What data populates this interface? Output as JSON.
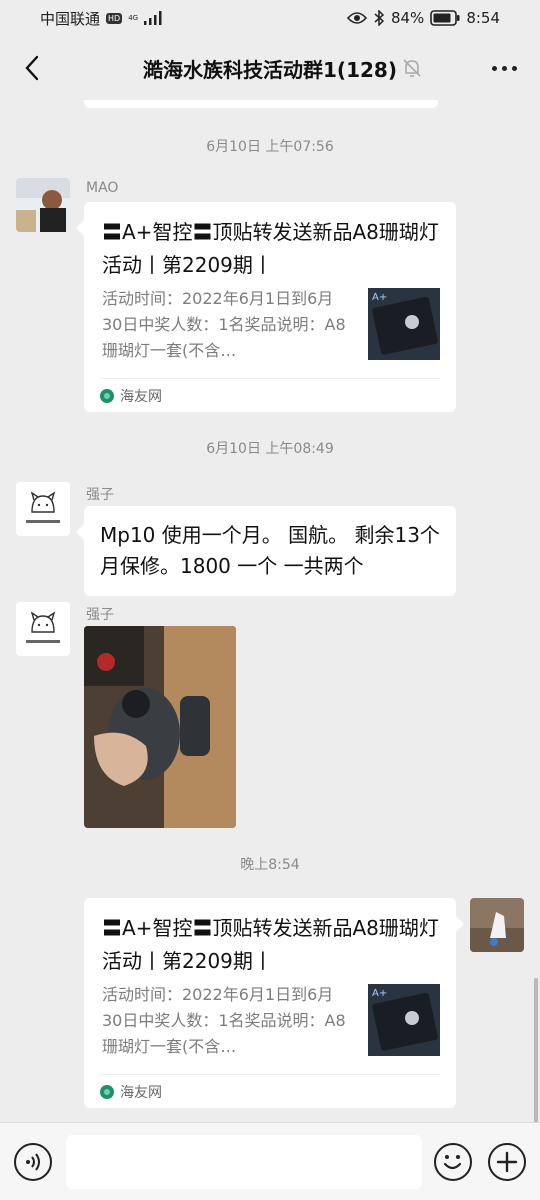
{
  "status": {
    "carrier": "中国联通",
    "hd": "HD",
    "net": "4G",
    "battery": "84%",
    "time": "8:54"
  },
  "header": {
    "title": "澔海水族科技活动群1(128)"
  },
  "messages": [
    {
      "time": "6月10日 上午07:56",
      "sender": "MAO",
      "card": {
        "title": "〓A+智控〓顶贴转发送新品A8珊瑚灯活动丨第2209期丨",
        "desc": "活动时间：2022年6月1日到6月30日中奖人数：1名奖品说明：A8珊瑚灯一套(不含…",
        "source": "海友网",
        "thumb_label": "A+"
      }
    },
    {
      "time": "6月10日 上午08:49",
      "sender": "强子",
      "text": "Mp10 使用一个月。 国航。 剩余13个月保修。1800 一个 一共两个"
    },
    {
      "sender": "强子",
      "image": "photo"
    },
    {
      "time": "晚上8:54",
      "card": {
        "title": "〓A+智控〓顶贴转发送新品A8珊瑚灯活动丨第2209期丨",
        "desc": "活动时间：2022年6月1日到6月30日中奖人数：1名奖品说明：A8珊瑚灯一套(不含…",
        "source": "海友网",
        "thumb_label": "A+"
      }
    }
  ],
  "input": {
    "placeholder": ""
  },
  "colors": {
    "background": "#ededed",
    "bubble": "#ffffff",
    "muted_text": "#8a8a8a"
  }
}
